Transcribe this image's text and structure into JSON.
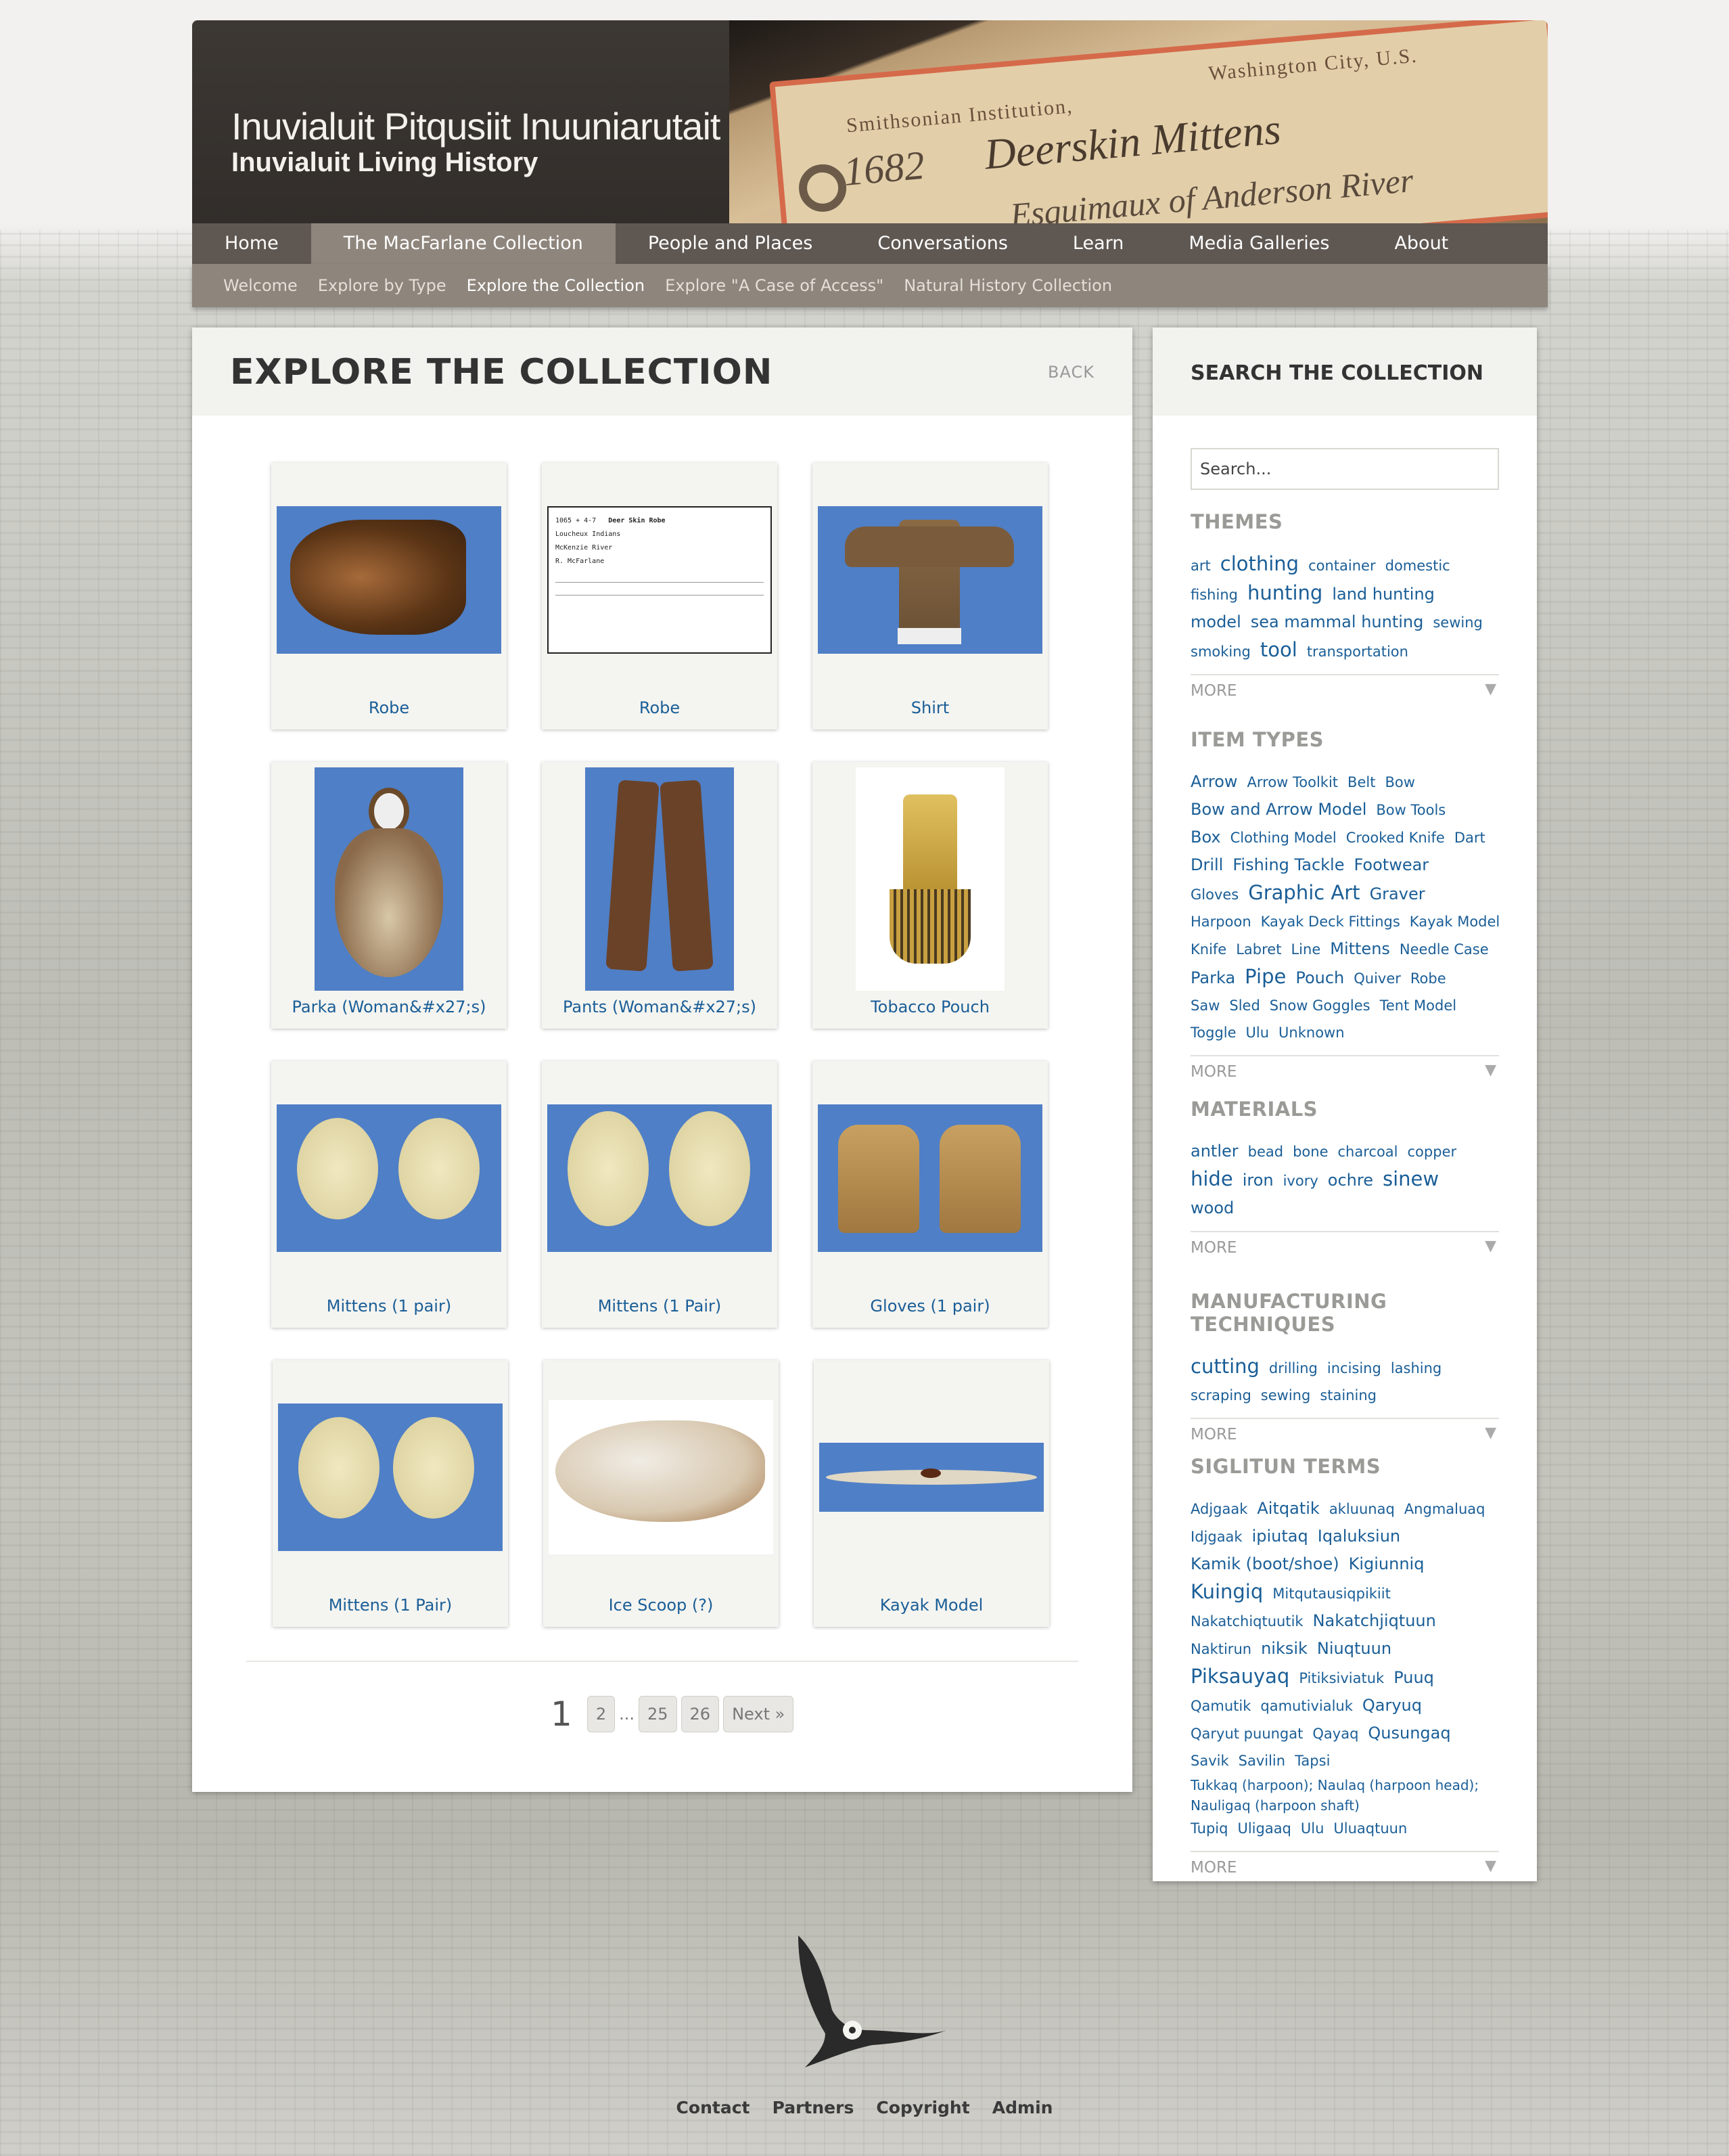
{
  "site": {
    "title": "Inuvialuit Pitqusiit Inuuniarutait",
    "subtitle": "Inuvialuit Living History"
  },
  "header_tag": {
    "institution": "Smithsonian Institution,",
    "city": "Washington City, U.S.",
    "number": "1682",
    "handwriting": "Deerskin Mittens",
    "handwriting2": "Esquimaux of Anderson River"
  },
  "nav": {
    "items": [
      {
        "label": "Home"
      },
      {
        "label": "The MacFarlane Collection",
        "active": true
      },
      {
        "label": "People and Places"
      },
      {
        "label": "Conversations"
      },
      {
        "label": "Learn"
      },
      {
        "label": "Media Galleries"
      },
      {
        "label": "About"
      }
    ]
  },
  "subnav": {
    "items": [
      {
        "label": "Welcome"
      },
      {
        "label": "Explore by Type"
      },
      {
        "label": "Explore the Collection",
        "active": true
      },
      {
        "label": "Explore \"A Case of Access\""
      },
      {
        "label": "Natural History Collection"
      }
    ]
  },
  "main": {
    "title": "EXPLORE THE COLLECTION",
    "back_label": "BACK",
    "items": [
      {
        "label": "Robe"
      },
      {
        "label": "Robe"
      },
      {
        "label": "Shirt"
      },
      {
        "label": "Parka (Woman&#x27;s)"
      },
      {
        "label": "Pants (Woman&#x27;s)"
      },
      {
        "label": "Tobacco Pouch"
      },
      {
        "label": "Mittens (1 pair)"
      },
      {
        "label": "Mittens (1 Pair)"
      },
      {
        "label": "Gloves (1 pair)"
      },
      {
        "label": "Mittens (1 Pair)"
      },
      {
        "label": "Ice Scoop (?)"
      },
      {
        "label": "Kayak Model"
      }
    ],
    "card_text": {
      "catalog_name": "Deer Skin Robe",
      "catalog_number": "1065 + 4-7",
      "catalog_people": "Loucheux Indians",
      "catalog_locality": "McKenzie River",
      "catalog_collection": "R. McFarlane"
    },
    "pagination": {
      "current": "1",
      "pages": [
        "2",
        "25",
        "26"
      ],
      "ellipsis": "...",
      "next": "Next »"
    }
  },
  "sidebar": {
    "title": "SEARCH THE COLLECTION",
    "search_placeholder": "Search...",
    "more_label": "MORE",
    "themes": {
      "title": "THEMES",
      "tags": [
        "art",
        "clothing",
        "container",
        "domestic",
        "fishing",
        "hunting",
        "land hunting",
        "model",
        "sea mammal hunting",
        "sewing",
        "smoking",
        "tool",
        "transportation"
      ]
    },
    "item_types": {
      "title": "ITEM TYPES",
      "tags": [
        "Arrow",
        "Arrow Toolkit",
        "Belt",
        "Bow",
        "Bow and Arrow Model",
        "Bow Tools",
        "Box",
        "Clothing Model",
        "Crooked Knife",
        "Dart",
        "Drill",
        "Fishing Tackle",
        "Footwear",
        "Gloves",
        "Graphic Art",
        "Graver",
        "Harpoon",
        "Kayak Deck Fittings",
        "Kayak Model",
        "Knife",
        "Labret",
        "Line",
        "Mittens",
        "Needle Case",
        "Parka",
        "Pipe",
        "Pouch",
        "Quiver",
        "Robe",
        "Saw",
        "Sled",
        "Snow Goggles",
        "Tent Model",
        "Toggle",
        "Ulu",
        "Unknown"
      ]
    },
    "materials": {
      "title": "MATERIALS",
      "tags": [
        "antler",
        "bead",
        "bone",
        "charcoal",
        "copper",
        "hide",
        "iron",
        "ivory",
        "ochre",
        "sinew",
        "wood"
      ]
    },
    "techniques": {
      "title": "MANUFACTURING TECHNIQUES",
      "tags": [
        "cutting",
        "drilling",
        "incising",
        "lashing",
        "scraping",
        "sewing",
        "staining"
      ]
    },
    "siglitun": {
      "title": "SIGLITUN TERMS",
      "tags": [
        "Adjgaak",
        "Aitqatik",
        "akluunaq",
        "Angmaluaq",
        "Idjgaak",
        "ipiutaq",
        "Iqaluksiun",
        "Kamik (boot/shoe)",
        "Kigiunniq",
        "Kuingiq",
        "Mitqutausiqpikiit",
        "Nakatchiqtuutik",
        "Nakatchjiqtuun",
        "Naktirun",
        "niksik",
        "Niuqtuun",
        "Piksauyaq",
        "Pitiksiviatuk",
        "Puuq",
        "Qamutik",
        "qamutivialuk",
        "Qaryuq",
        "Qaryut puungat",
        "Qayaq",
        "Qusungaq",
        "Savik",
        "Savilin",
        "Tapsi",
        "Tukkaq (harpoon); Naulaq (harpoon head); Nauligaq (harpoon shaft)",
        "Tupiq",
        "Uligaaq",
        "Ulu",
        "Uluaqtuun"
      ]
    }
  },
  "footer": {
    "links": [
      "Contact",
      "Partners",
      "Copyright",
      "Admin"
    ]
  }
}
